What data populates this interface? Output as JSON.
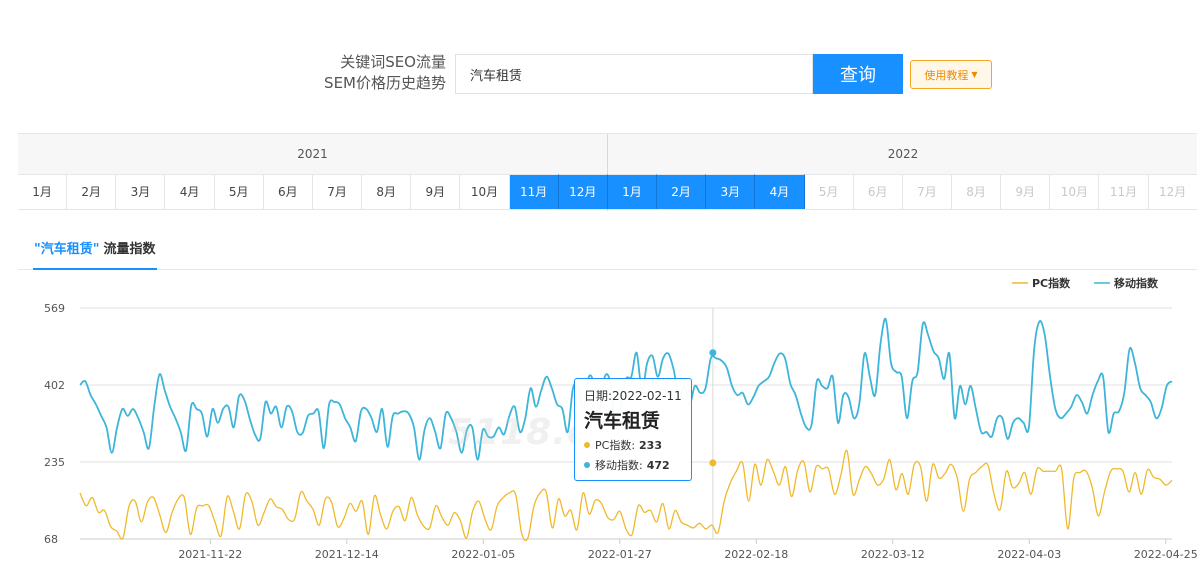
{
  "search": {
    "label_line1": "关键词SEO流量",
    "label_line2": "SEM价格历史趋势",
    "value": "汽车租赁",
    "button_label": "查询",
    "tutorial_label": "使用教程"
  },
  "month_picker": {
    "years": [
      "2021",
      "2022"
    ],
    "months": [
      {
        "label": "1月",
        "state": "normal"
      },
      {
        "label": "2月",
        "state": "normal"
      },
      {
        "label": "3月",
        "state": "normal"
      },
      {
        "label": "4月",
        "state": "normal"
      },
      {
        "label": "5月",
        "state": "normal"
      },
      {
        "label": "6月",
        "state": "normal"
      },
      {
        "label": "7月",
        "state": "normal"
      },
      {
        "label": "8月",
        "state": "normal"
      },
      {
        "label": "9月",
        "state": "normal"
      },
      {
        "label": "10月",
        "state": "normal"
      },
      {
        "label": "11月",
        "state": "active"
      },
      {
        "label": "12月",
        "state": "active"
      },
      {
        "label": "1月",
        "state": "active"
      },
      {
        "label": "2月",
        "state": "active"
      },
      {
        "label": "3月",
        "state": "active"
      },
      {
        "label": "4月",
        "state": "active"
      },
      {
        "label": "5月",
        "state": "disabled"
      },
      {
        "label": "6月",
        "state": "disabled"
      },
      {
        "label": "7月",
        "state": "disabled"
      },
      {
        "label": "8月",
        "state": "disabled"
      },
      {
        "label": "9月",
        "state": "disabled"
      },
      {
        "label": "10月",
        "state": "disabled"
      },
      {
        "label": "11月",
        "state": "disabled"
      },
      {
        "label": "12月",
        "state": "disabled"
      }
    ]
  },
  "tab": {
    "keyword": "\"汽车租赁\"",
    "suffix": "流量指数"
  },
  "tooltip": {
    "date": "日期:2022-02-11",
    "keyword": "汽车租赁",
    "pc_label": "PC指数:",
    "pc_value": "233",
    "mobile_label": "移动指数:",
    "mobile_value": "472"
  },
  "watermark": "5118.com",
  "colors": {
    "accent": "#1890ff",
    "pc": "#f0b92b",
    "mobile": "#3db5d9",
    "tutorial": "#f08a00"
  },
  "chart_data": {
    "type": "line",
    "x_start": "2021-11-01",
    "x_end": "2022-04-26",
    "x_tick_labels": [
      "2021-11-22",
      "2021-12-14",
      "2022-01-05",
      "2022-01-27",
      "2022-02-18",
      "2022-03-12",
      "2022-04-03",
      "2022-04-25"
    ],
    "y_ticks": [
      68,
      235,
      402,
      569
    ],
    "ylim": [
      68,
      569
    ],
    "grid": true,
    "legend_position": "top-right",
    "highlight_date": "2022-02-11",
    "series": [
      {
        "name": "PC指数",
        "color": "#f0b92b",
        "values": [
          168,
          140,
          158,
          126,
          130,
          95,
          85,
          70,
          140,
          150,
          105,
          148,
          158,
          120,
          82,
          125,
          155,
          158,
          78,
          135,
          140,
          140,
          105,
          75,
          160,
          128,
          90,
          165,
          150,
          98,
          125,
          155,
          138,
          132,
          110,
          112,
          170,
          150,
          132,
          98,
          155,
          148,
          95,
          112,
          145,
          128,
          150,
          78,
          162,
          120,
          90,
          128,
          138,
          108,
          158,
          120,
          96,
          92,
          140,
          115,
          98,
          125,
          108,
          70,
          128,
          150,
          112,
          88,
          140,
          158,
          168,
          165,
          80,
          70,
          140,
          168,
          170,
          92,
          155,
          118,
          130,
          88,
          168,
          122,
          152,
          145,
          115,
          110,
          128,
          90,
          78,
          140,
          126,
          130,
          105,
          145,
          90,
          130,
          105,
          98,
          92,
          102,
          90,
          98,
          82,
          150,
          190,
          215,
          233,
          150,
          230,
          185,
          240,
          215,
          185,
          225,
          160,
          218,
          235,
          170,
          225,
          220,
          220,
          165,
          205,
          260,
          165,
          195,
          225,
          210,
          185,
          198,
          240,
          175,
          210,
          165,
          230,
          225,
          150,
          230,
          200,
          210,
          230,
          200,
          128,
          198,
          212,
          225,
          228,
          165,
          132,
          215,
          180,
          188,
          212,
          165,
          220,
          215,
          215,
          215,
          220,
          90,
          200,
          212,
          215,
          180,
          118,
          170,
          215,
          220,
          215,
          170,
          212,
          165,
          218,
          202,
          198,
          185,
          195
        ],
        "note": "read from chart; approximate"
      },
      {
        "name": "移动指数",
        "color": "#3db5d9",
        "values": [
          402,
          410,
          380,
          360,
          335,
          310,
          255,
          310,
          350,
          335,
          350,
          330,
          300,
          265,
          355,
          425,
          390,
          355,
          330,
          300,
          260,
          358,
          350,
          340,
          290,
          350,
          320,
          350,
          355,
          310,
          378,
          370,
          330,
          295,
          285,
          365,
          340,
          355,
          310,
          355,
          345,
          300,
          298,
          335,
          340,
          345,
          265,
          360,
          365,
          360,
          330,
          310,
          280,
          345,
          350,
          330,
          300,
          350,
          268,
          335,
          340,
          345,
          340,
          310,
          240,
          305,
          330,
          300,
          265,
          340,
          330,
          300,
          255,
          305,
          310,
          240,
          305,
          290,
          290,
          310,
          295,
          335,
          355,
          300,
          330,
          395,
          355,
          390,
          420,
          395,
          360,
          350,
          300,
          395,
          400,
          350,
          420,
          405,
          350,
          420,
          410,
          320,
          360,
          415,
          420,
          472,
          390,
          450,
          465,
          420,
          460,
          470,
          435,
          375,
          400,
          360,
          400,
          385,
          395,
          460,
          460,
          455,
          440,
          400,
          380,
          385,
          360,
          375,
          400,
          410,
          420,
          450,
          470,
          460,
          405,
          380,
          340,
          310,
          315,
          410,
          400,
          395,
          420,
          320,
          380,
          375,
          330,
          360,
          470,
          420,
          380,
          490,
          545,
          450,
          430,
          420,
          330,
          410,
          430,
          535,
          510,
          475,
          460,
          415,
          470,
          330,
          400,
          360,
          400,
          350,
          300,
          300,
          290,
          330,
          330,
          285,
          320,
          330,
          320,
          310,
          480,
          540,
          510,
          420,
          350,
          330,
          340,
          355,
          380,
          365,
          340,
          380,
          410,
          420,
          300,
          340,
          345,
          385,
          480,
          450,
          395,
          380,
          365,
          330,
          350,
          400,
          410
        ]
      }
    ]
  }
}
